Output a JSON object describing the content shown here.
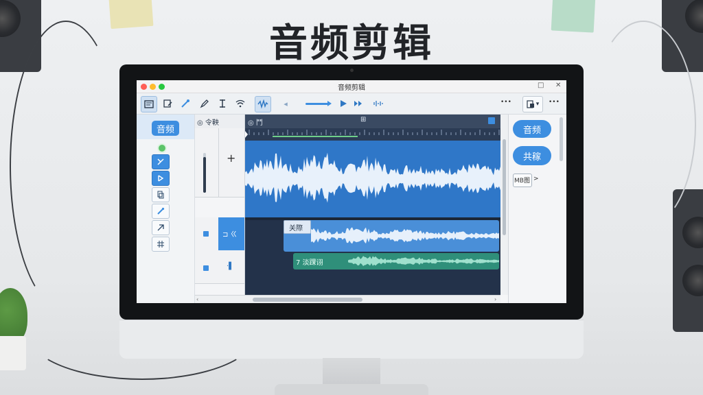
{
  "poster": {
    "headline": "音频剪辑"
  },
  "window": {
    "title": "音频剪辑",
    "controls": {
      "minimize": "□",
      "close": "✕"
    },
    "traffic_lights": [
      "#ff5f57",
      "#febc2e",
      "#28c840"
    ]
  },
  "toolbar": {
    "left_icons": [
      "list-icon",
      "edit-icon",
      "magic-icon",
      "pen-icon",
      "trim-icon",
      "wireless-icon"
    ],
    "active_icon": "waveform-select-icon",
    "nav_back": "◂",
    "more_left": "•••",
    "more_right": "•••",
    "export_arrow": "▾"
  },
  "left_sidebar": {
    "primary_button": "音频",
    "tools": [
      "cut-icon",
      "trim-icon",
      "copy-icon",
      "marker-icon",
      "arrow-icon",
      "grid-icon"
    ]
  },
  "track_headers": {
    "title": "◎ 令鞅",
    "add_symbol": "+",
    "track2_label": "⊐ ㄍ",
    "track3_label": "·▌"
  },
  "timeline": {
    "ruler_icons": [
      "◎ 鬥",
      "⊞"
    ],
    "clip_a_label": "关際",
    "clip_b_label": "7 淡踝诩"
  },
  "right_panel": {
    "button_1": "音频",
    "button_2": "共稼",
    "pill_label": "MB图",
    "pill_arrow": ">"
  },
  "colors": {
    "accent": "#3d8ee0",
    "timeline_bg": "#23324a",
    "track1": "#2f77c8",
    "track2": "#4a8fd8",
    "track3": "#2f8f7a"
  }
}
